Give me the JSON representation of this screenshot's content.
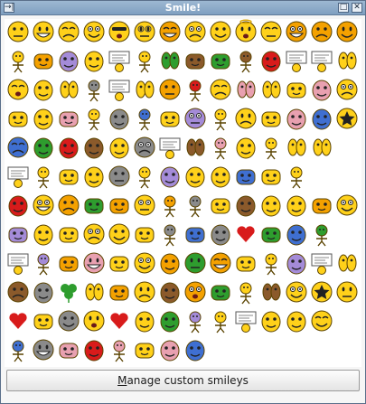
{
  "window": {
    "title": "Smile!",
    "pin_glyph": "→|",
    "maximize_glyph": "□",
    "close_glyph": "✕"
  },
  "top_row": [
    {
      "name": "smile-basic-icon"
    },
    {
      "name": "smile-neutral-icon"
    },
    {
      "name": "smile-sad-icon"
    },
    {
      "name": "smile-unsure-icon"
    },
    {
      "name": "smile-cool-icon"
    },
    {
      "name": "smile-nerd-icon"
    },
    {
      "name": "smile-orange-icon"
    },
    {
      "name": "smile-whistle-icon"
    },
    {
      "name": "smile-shocked-icon"
    },
    {
      "name": "smile-angel-icon"
    },
    {
      "name": "smile-blush-icon"
    },
    {
      "name": "smile-big-orange-icon"
    },
    {
      "name": "smile-grin-icon"
    },
    {
      "name": "smile-surprised-icon"
    }
  ],
  "colors": {
    "face": "#ffd11a",
    "face_dark": "#e2a800",
    "orange": "#f4a100",
    "red": "#d81b1b",
    "blue": "#3f6fd1",
    "green": "#2e9d2e",
    "gray": "#8a8a8a",
    "brown": "#8b5a2b",
    "pink": "#e8a0b0",
    "purple": "#a48bd8",
    "outline": "#5a4300"
  },
  "grid_rows": [
    [
      "dance-icon",
      "tired-icon",
      "troll-face-icon",
      "moon-face-icon",
      "sign-icon",
      "pointing-icon",
      "blue-oval-icon",
      "cat-icon",
      "cat-yellow-icon",
      "chef-icon",
      "lemons-icon",
      "pig-card-icon",
      "sign-board-icon",
      "eyes-icon"
    ],
    [
      "bunny-icon",
      "cheer-icon",
      "blue-oval2-icon",
      "drum-icon",
      "lol-sign-icon",
      "peanut-icon",
      "fingers-icon",
      "bird-icon",
      "grin-face-icon",
      "eyebrow-face-icon",
      "peanuts-icon",
      "blue-flag-icon",
      "yellow-icon",
      "confused-icon"
    ],
    [
      "devil-face-icon",
      "cry-icon",
      "red-mask-icon",
      "puppet-icon",
      "jump-icon",
      "marching-icon",
      "duck-icon",
      "pray-icon",
      "knife-icon",
      "tongue-icon",
      "slam-icon",
      "cloud-icon",
      "pout-icon",
      "star-icon"
    ],
    [
      "laugh-icon",
      "sheep-icon",
      "grin-big-icon",
      "rooster-icon",
      "bunny-feet-icon",
      "wave-icon",
      "help-sign-icon",
      "eyes-peek-icon",
      "egg-icon",
      "ninja-icon",
      "blue-face-icon",
      "red-eyes-icon",
      "red-eye2-icon",
      "blank-icon"
    ],
    [
      "sign-sm-icon",
      "walk-icon",
      "dots-icon",
      "panda-icon",
      "dog-icon",
      "flower-bunch-icon",
      "angry-face-icon",
      "stick-icon",
      "leaf-icon",
      "blue-ball-icon",
      "balloons-icon",
      "broken-icon",
      "blank2-icon",
      "blank3-icon"
    ],
    [
      "flower-icon",
      "confetti-icon",
      "cow-icon",
      "moose-icon",
      "gold-icon",
      "bear-icon",
      "drums-icon",
      "wolf-icon",
      "dog2-icon",
      "help-face-icon",
      "question-icon",
      "worried-icon",
      "laughing-icon",
      "dumbbell-icon"
    ],
    [
      "weight-icon",
      "snowman-icon",
      "baseball-icon",
      "dog3-icon",
      "bee-icon",
      "teddy-icon",
      "bow-icon",
      "cat-sit-icon",
      "nose-icon",
      "hearts-icon",
      "thankyou-icon",
      "fire-face-icon",
      "big-smile-icon",
      "blank4-icon"
    ],
    [
      "list-icon",
      "cheer2-icon",
      "pc-icon",
      "soccer-icon",
      "cow2-icon",
      "poop-icon",
      "hand-icon",
      "scream-icon",
      "sweat-icon",
      "sun-icon",
      "tooth-icon",
      "purple-blob-icon",
      "google-icon",
      "peanut2-icon"
    ],
    [
      "hat-icon",
      "pyramid-icon",
      "clover-icon",
      "crosseyes-icon",
      "happy-face-icon",
      "teeth-grin-icon",
      "glance-icon",
      "wink-icon",
      "chunky-icon",
      "ball-icon",
      "wide-eye-icon",
      "fear-icon",
      "star-face-icon",
      "snooze-icon"
    ],
    [
      "hearts-eyes-icon",
      "puzzled-icon",
      "bubbles-icon",
      "green-face-icon",
      "heart-icon",
      "stick-fig-icon",
      "neutral-face-icon",
      "grinning-icon",
      "tongue2-icon",
      "sorry-sign-icon",
      "shocked-face-icon",
      "smile-small-icon",
      "stick-man-icon",
      "blank5-icon"
    ],
    [
      "thumbs-up-icon",
      "cheers-icon",
      "bows-icon",
      "chick-icon",
      "chef2-icon",
      "tombstone-icon",
      "cat-sm-icon",
      "burst-icon",
      "blank6-icon",
      "blank7-icon",
      "blank8-icon",
      "blank9-icon",
      "blank10-icon",
      "blank11-icon"
    ]
  ],
  "manage_button": {
    "label_prefix": "",
    "label_underlined": "M",
    "label_rest": "anage custom smileys"
  }
}
